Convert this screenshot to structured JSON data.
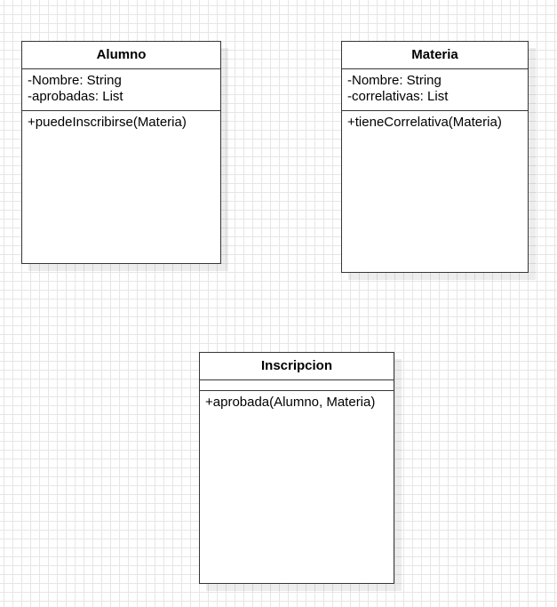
{
  "classes": {
    "alumno": {
      "name": "Alumno",
      "attributes": [
        "-Nombre: String",
        "-aprobadas: List"
      ],
      "methods": [
        "+puedeInscribirse(Materia)"
      ]
    },
    "materia": {
      "name": "Materia",
      "attributes": [
        "-Nombre: String",
        "-correlativas: List"
      ],
      "methods": [
        "+tieneCorrelativa(Materia)"
      ]
    },
    "inscripcion": {
      "name": "Inscripcion",
      "attributes": [],
      "methods": [
        "+aprobada(Alumno, Materia)"
      ]
    }
  }
}
